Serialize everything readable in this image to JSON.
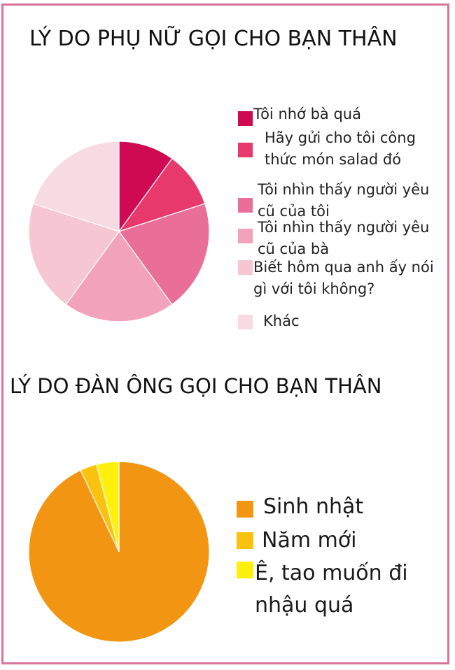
{
  "charts": [
    {
      "title": "LÝ DO PHỤ NỮ GỌI CHO BẠN THÂN",
      "chart_data": {
        "type": "pie",
        "title": "LÝ DO PHỤ NỮ GỌI CHO BẠN THÂN",
        "labels": [
          "Tôi nhớ bà quá",
          "Hãy gửi cho tôi công\nthức món salad đó",
          "Tôi nhìn thấy người yêu\ncũ của tôi",
          "Tôi nhìn thấy người yêu\ncũ của bà",
          "Biết hôm qua anh ấy nói\ngì với tôi không?",
          "Khác"
        ],
        "values": [
          10,
          10,
          20,
          20,
          20,
          20
        ],
        "colors": [
          "#cf0a52",
          "#e8396d",
          "#ea6f98",
          "#f2a2ba",
          "#f6c6d3",
          "#f7dbe3"
        ],
        "legend_position": "right"
      }
    },
    {
      "title": "LÝ DO ĐÀN ÔNG GỌI CHO BẠN THÂN",
      "chart_data": {
        "type": "pie",
        "title": "LÝ DO ĐÀN ÔNG GỌI CHO BẠN THÂN",
        "labels": [
          "Sinh nhật",
          "Năm mới",
          "Ê, tao muốn đi\nnhậu quá"
        ],
        "values": [
          93,
          3,
          4
        ],
        "colors": [
          "#f29513",
          "#f8c20f",
          "#fdf00c"
        ],
        "legend_position": "right"
      }
    }
  ]
}
